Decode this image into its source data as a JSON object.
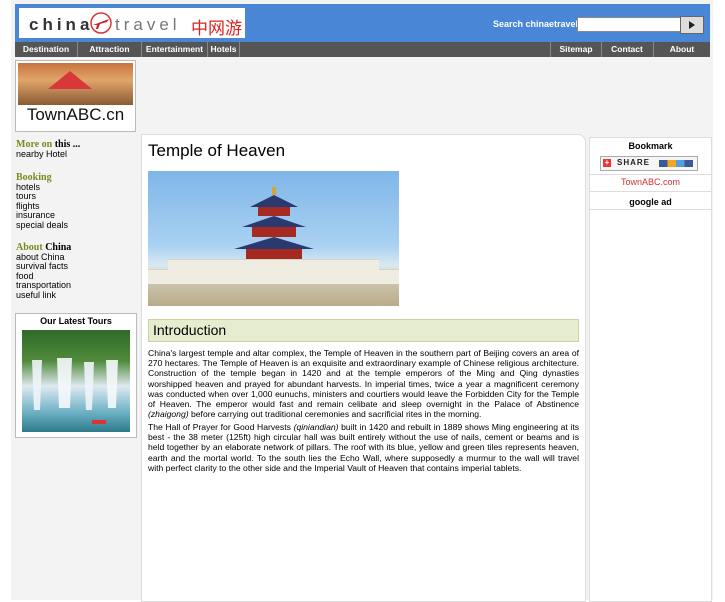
{
  "header": {
    "logo_china": "china",
    "logo_travel": "travel",
    "logo_cn": "中网游",
    "search_label": "Search chinaetravel :",
    "search_value": "",
    "search_button_icon": "play-arrow-icon"
  },
  "nav": {
    "left": [
      "Destination",
      "Attraction",
      "Entertainment",
      "Hotels"
    ],
    "right": [
      "Sitemap",
      "Contact",
      "About"
    ]
  },
  "townabc_logo": {
    "text": "TownABC.cn"
  },
  "sidebar": {
    "more_on_prefix": "More on",
    "more_on_suffix": "this ...",
    "more_on_links": [
      "nearby Hotel"
    ],
    "booking_heading": "Booking",
    "booking_links": [
      "hotels",
      "tours",
      "flights",
      "insurance",
      "special deals"
    ],
    "about_prefix": "About",
    "about_suffix": "China",
    "about_links": [
      "about China",
      "survival facts",
      "food",
      "transportation",
      "useful link"
    ]
  },
  "latest_tours": {
    "title": "Our Latest Tours"
  },
  "main": {
    "title": "Temple of Heaven",
    "intro_heading": "Introduction",
    "p1": "China's largest temple and altar complex, the Temple of Heaven in the southern part of Beijing covers an area of 270 hectares. The Temple of Heaven is an exquisite and extraordinary example of Chinese religious architecture. Construction of the temple began in 1420 and at the temple emperors of the Ming and Qing dynasties worshipped heaven and prayed for abundant harvests. In imperial times, twice a year a magnificent ceremony was conducted when over 1,000 eunuchs, ministers and courtiers would leave the Forbidden City for the Temple of Heaven. The emperor would fast and remain celibate and sleep overnight in the Palace of Abstinence",
    "p1_italic": "(zhaigong)",
    "p1_end": "before carrying out traditional ceremonies and sacrificial rites in the morning.",
    "p2_start": "The Hall of Prayer for Good Harvests",
    "p2_italic": "(qiniandian)",
    "p2_end": "built in 1420 and rebuilt in 1889 shows Ming engineering at its best - the 38 meter (125ft) high circular hall was built entirely without the use of nails, cement or beams and is held together by an elaborate network of pillars. The roof with its blue, yellow and green tiles represents heaven, earth and the mortal world. To the south lies the Echo Wall, where supposedly a murmur to the wall will travel with perfect clarity to the other side and the Imperial Vault of Heaven that contains imperial tablets."
  },
  "right": {
    "bookmark_title": "Bookmark",
    "share_label": "SHARE",
    "townabc_link": "TownABC.com",
    "google_ad_title": "google ad"
  }
}
